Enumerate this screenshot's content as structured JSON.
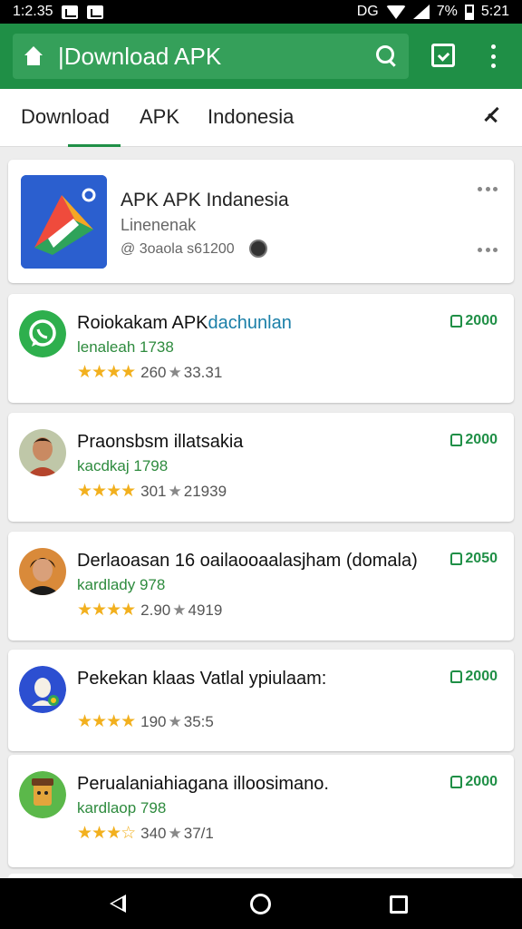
{
  "status_bar": {
    "time": "1:2.35",
    "network": "DG",
    "battery": "7%",
    "clock_right": "5:21"
  },
  "app_bar": {
    "search_text": "|Download APK"
  },
  "tabs": [
    {
      "label": "Download"
    },
    {
      "label": "APK"
    },
    {
      "label": "Indonesia"
    }
  ],
  "hero": {
    "title": "APK APK Indanesia",
    "subtitle": "Linenenak",
    "meta": "@ 3oaola s61200"
  },
  "apps": [
    {
      "name_main": "Roiokakam APK",
      "name_highlight": "dachunlan",
      "sub": "lenaleah 1738",
      "stars": "★★★★",
      "rating": "260",
      "count": "33.31",
      "price": "2000"
    },
    {
      "name_main": "Praonsbsm illatsakia",
      "name_highlight": "",
      "sub": "kacdkaj 1798",
      "stars": "★★★★",
      "rating": "301",
      "count": "21939",
      "price": "2000"
    },
    {
      "name_main": "Derlaoasan 16 oailaooaalasjham (domala)",
      "name_highlight": "",
      "sub": "kardlady 978",
      "stars": "★★★★",
      "rating": "2.90",
      "count": "4919",
      "price": "2050"
    },
    {
      "name_main": "Pekekan klaas Vatlal ypiulaam:",
      "name_highlight": "",
      "sub": "",
      "stars": "★★★★",
      "rating": "190",
      "count": "35:5",
      "price": "2000"
    },
    {
      "name_main": "Perualaniahiagana illoosimano.",
      "name_highlight": "",
      "sub": "kardlaop 798",
      "stars": "★★★☆",
      "rating": "340",
      "count": "37/1",
      "price": "2000"
    }
  ],
  "colors": {
    "primary": "#1f8f46",
    "star": "#f2b01e",
    "link": "#1a7fa8"
  }
}
